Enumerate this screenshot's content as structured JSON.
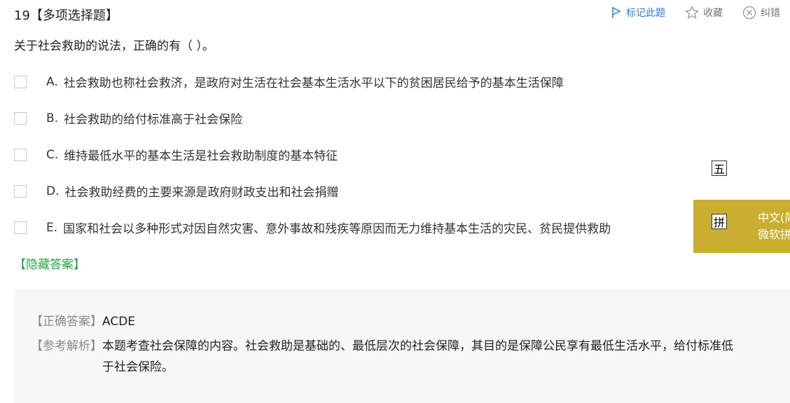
{
  "question": {
    "header": "19【多项选择题】",
    "stem": "关于社会救助的说法，正确的有（    ）。"
  },
  "toolbar": {
    "mark_label": "标记此题",
    "favorite_label": "收藏",
    "correct_label": "纠错"
  },
  "options": [
    {
      "letter": "A.",
      "text": "社会救助也称社会救济，是政府对生活在社会基本生活水平以下的贫困居民给予的基本生活保障"
    },
    {
      "letter": "B.",
      "text": "社会救助的给付标准高于社会保险"
    },
    {
      "letter": "C.",
      "text": "维持最低水平的基本生活是社会救助制度的基本特征"
    },
    {
      "letter": "D.",
      "text": "社会救助经费的主要来源是政府财政支出和社会捐赠"
    },
    {
      "letter": "E.",
      "text": "国家和社会以多种形式对因自然灾害、意外事故和残疾等原因而无力维持基本生活的灾民、贫民提供救助"
    }
  ],
  "hide_answer_label": "【隐藏答案】",
  "answer": {
    "correct_label": "【正确答案】",
    "correct_value": "ACDE",
    "analysis_label": "【参考解析】",
    "analysis_line1": "本题考查社会保障的内容。社会救助是基础的、最低层次的社会保障，其目的是保障公民享有最低生活水平，给付标准低",
    "analysis_line2": "于社会保险。"
  },
  "ime": {
    "mode_char": "五",
    "pin_char": "拼",
    "line1": "中文(简",
    "line2": "微软拼音",
    "panel_color": "#c9ae30"
  },
  "colors": {
    "accent_blue": "#2f7bd8",
    "accent_green": "#2ea04b"
  }
}
